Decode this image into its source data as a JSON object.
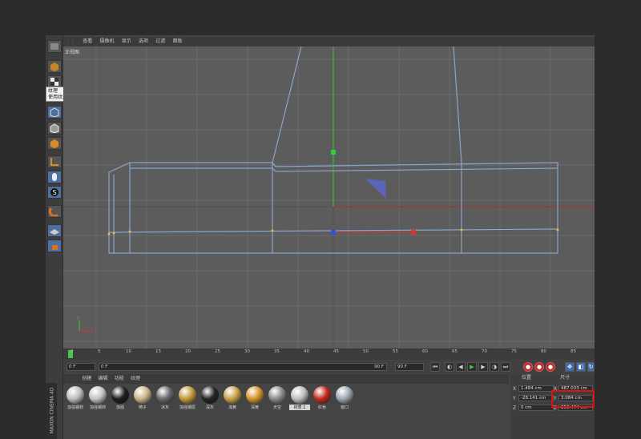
{
  "viewport": {
    "menu": [
      "查看",
      "摄像机",
      "显示",
      "选项",
      "过滤",
      "面板"
    ],
    "label": "正视图"
  },
  "tooltip": {
    "title": "纹理",
    "text": "使用纹理模式"
  },
  "left_toolbar": [
    "cube-icon",
    "texture-checker-icon",
    "model-mode-icon",
    "points-mode-icon",
    "edges-mode-icon",
    "polygons-mode-icon",
    "axis-icon",
    "tweak-icon",
    "snap-icon",
    "magnet-icon",
    "workplane-icon",
    "lock-icon"
  ],
  "timeline": {
    "ticks": [
      "0",
      "5",
      "10",
      "15",
      "20",
      "25",
      "30",
      "35",
      "40",
      "45",
      "50",
      "55",
      "60",
      "65",
      "70",
      "75",
      "80",
      "85"
    ],
    "current_frame": "0 F",
    "preview_start": "0 F",
    "preview_end": "90 F",
    "end_frame": "90 F"
  },
  "material_manager": {
    "menu": [
      "创建",
      "编辑",
      "功能",
      "纹理"
    ],
    "materials": [
      {
        "label": "加强钢材",
        "color": "#bcbcbc"
      },
      {
        "label": "加强钢材",
        "color": "#c4c4c4"
      },
      {
        "label": "加强",
        "color": "#1e1e1e"
      },
      {
        "label": "椅子",
        "color": "#c9b48a"
      },
      {
        "label": "冰灰",
        "color": "#6a6a6a"
      },
      {
        "label": "加强钢原",
        "color": "#c49a3a"
      },
      {
        "label": "深灰",
        "color": "#252525"
      },
      {
        "label": "浅黄",
        "color": "#c8a24a"
      },
      {
        "label": "深黄",
        "color": "#d4952a"
      },
      {
        "label": "天空",
        "color": "#8a8a8a"
      },
      {
        "label": "材质.1",
        "color": "#bfbfbf"
      },
      {
        "label": "红色",
        "color": "#c22a22"
      },
      {
        "label": "窗口",
        "color": "#9aa8b2"
      }
    ],
    "brand": "MAXON CINEMA 4D"
  },
  "coordinates": {
    "position_header": "位置",
    "size_header": "尺寸",
    "position": {
      "x": "1.484 cm",
      "y": "-28.141 cm",
      "z": "0 cm"
    },
    "size": {
      "x": "487.033 cm",
      "y": "3.084 cm",
      "z": "250.474 cm"
    },
    "axis_labels": {
      "x": "X",
      "y": "Y",
      "z": "Z"
    }
  },
  "colors": {
    "x_axis": "#e03030",
    "y_axis": "#30d030",
    "z_axis": "#3050e0",
    "wire": "#8aa4cc",
    "highlight": "#e01010",
    "timeline_current": "#45c845"
  }
}
